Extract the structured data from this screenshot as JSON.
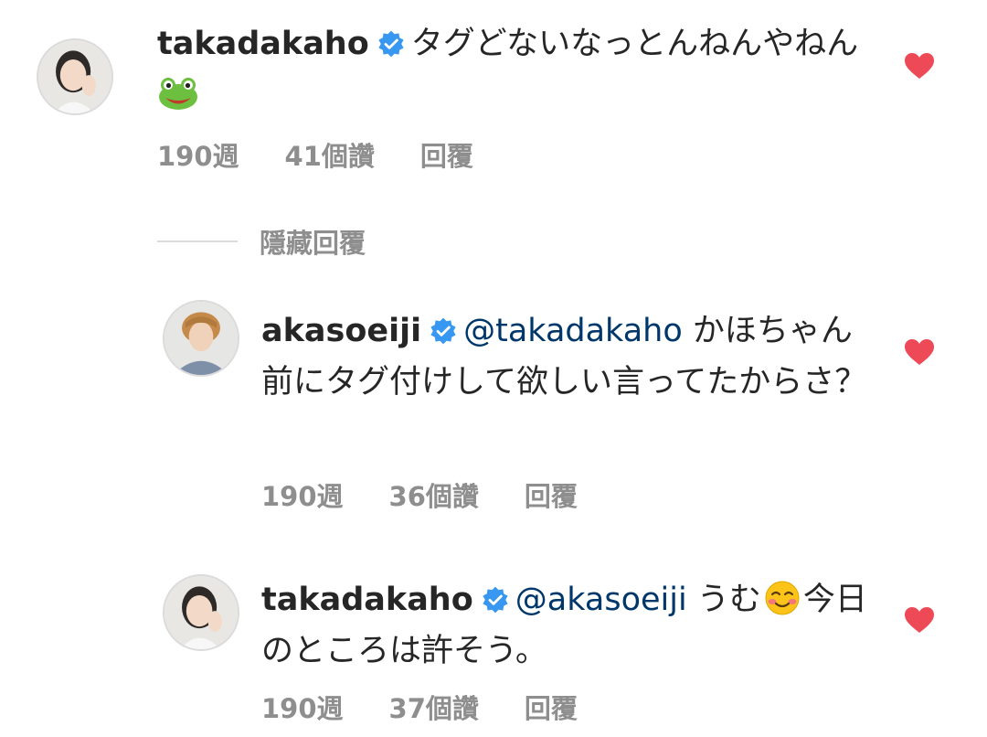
{
  "comments": [
    {
      "username": "takadakaho",
      "text": "タグどないなっとんねんやねん",
      "emoji": "frog-emoji",
      "time": "190週",
      "likes": "41個讚",
      "reply": "回覆"
    },
    {
      "username": "akasoeiji",
      "mention": "@takadakaho",
      "text": "かほちゃん前にタグ付けして欲しい言ってたからさ？",
      "time": "190週",
      "likes": "36個讚",
      "reply": "回覆"
    },
    {
      "username": "takadakaho",
      "mention": "@akasoeiji",
      "text_before": "うむ",
      "emoji": "smiling-blush-emoji",
      "text_after": "今日のところは許そう。",
      "time": "190週",
      "likes": "37個讚",
      "reply": "回覆"
    }
  ],
  "hidden_replies_label": "隱藏回覆",
  "colors": {
    "heart": "#ed4956",
    "verified": "#3897f0",
    "mention": "#00376b",
    "meta": "#8e8e8e"
  }
}
